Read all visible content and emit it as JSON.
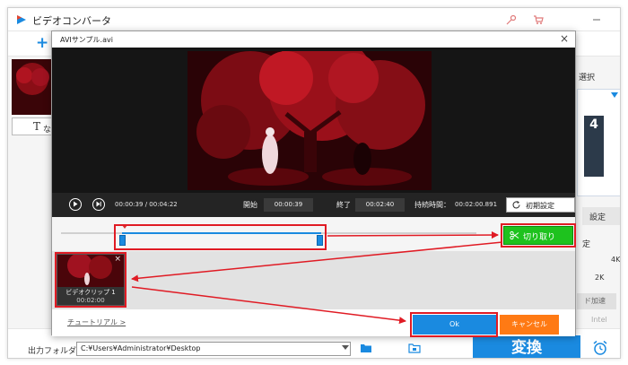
{
  "app": {
    "title": "ビデオコンバータ",
    "add_icon": "plus-icon",
    "subtitle_icon": "T",
    "subtitle_label": "なし",
    "right_panel": {
      "select_label": "選択",
      "format_label": "4",
      "settings_label": "設定",
      "setting2_label": "定",
      "res_4k": "4K",
      "res_2k": "2K",
      "accel_label": "ド加速",
      "intel_label": "Intel"
    },
    "output_label": "出力フォルダ：",
    "output_path": "C:¥Users¥Administrator¥Desktop",
    "convert_label": "変換"
  },
  "dialog": {
    "title": "AVIサンプル.avi",
    "current_time": "00:00:39",
    "time_sep": "/",
    "total_time": "00:04:22",
    "start_label": "開始",
    "start_value": "00:00:39",
    "end_label": "終了",
    "end_value": "00:02:40",
    "duration_label": "持続時間：",
    "duration_value": "00:02:00.891",
    "reset_label": "初期設定",
    "cut_label": "切り取り",
    "clip": {
      "name": "ビデオクリップ 1",
      "duration": "00:02:00"
    },
    "tutorial_label": "チュートリアル >",
    "ok_label": "Ok",
    "cancel_label": "キャンセル"
  },
  "colors": {
    "accent": "#1a8ae0",
    "cut_button": "#1ec21e",
    "cancel_button": "#ff7a14",
    "highlight": "#e01b24"
  }
}
